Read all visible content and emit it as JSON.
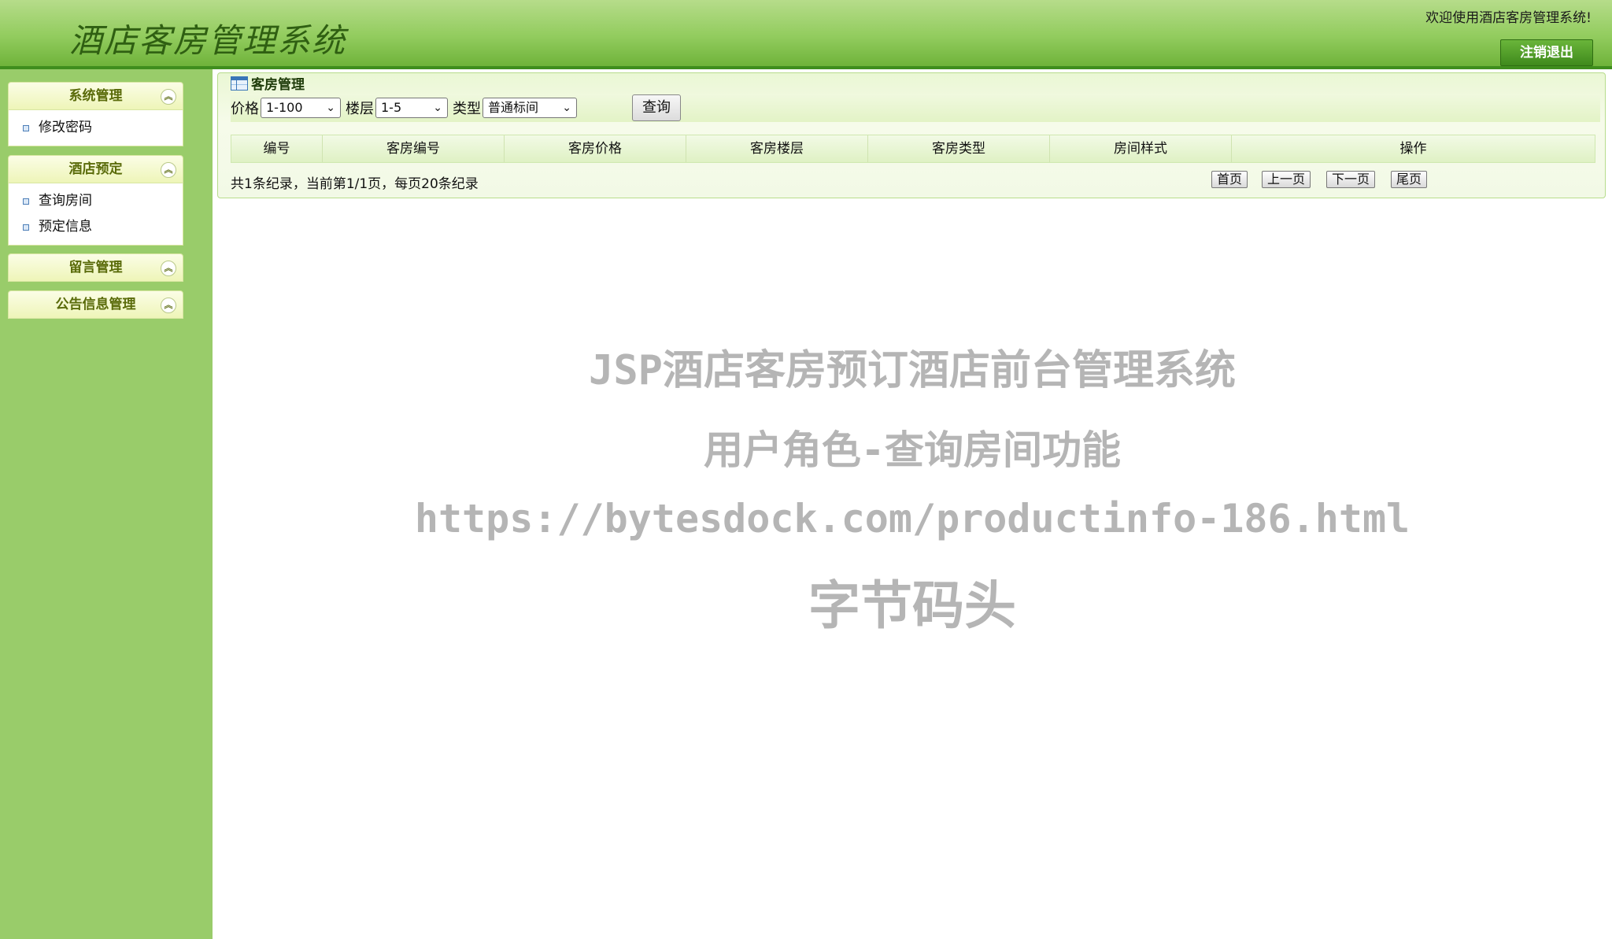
{
  "header": {
    "app_title": "酒店客房管理系统",
    "welcome": "欢迎使用酒店客房管理系统!",
    "logout_label": "注销退出"
  },
  "sidebar": {
    "groups": [
      {
        "title": "系统管理",
        "items": [
          "修改密码"
        ]
      },
      {
        "title": "酒店预定",
        "items": [
          "查询房间",
          "预定信息"
        ]
      },
      {
        "title": "留言管理",
        "items": []
      },
      {
        "title": "公告信息管理",
        "items": []
      }
    ]
  },
  "panel": {
    "title": "客房管理",
    "filters": {
      "price_label": "价格",
      "price_value": "1-100",
      "floor_label": "楼层",
      "floor_value": "1-5",
      "type_label": "类型",
      "type_value": "普通标间",
      "query_label": "查询"
    },
    "table": {
      "columns": [
        "编号",
        "客房编号",
        "客房价格",
        "客房楼层",
        "客房类型",
        "房间样式",
        "操作"
      ]
    },
    "pager": {
      "info": "共1条纪录，当前第1/1页，每页20条纪录",
      "first": "首页",
      "prev": "上一页",
      "next": "下一页",
      "last": "尾页"
    }
  },
  "watermark": {
    "line1": "JSP酒店客房预订酒店前台管理系统",
    "line2": "用户角色-查询房间功能",
    "line3": "https://bytesdock.com/productinfo-186.html",
    "line4": "字节码头"
  }
}
